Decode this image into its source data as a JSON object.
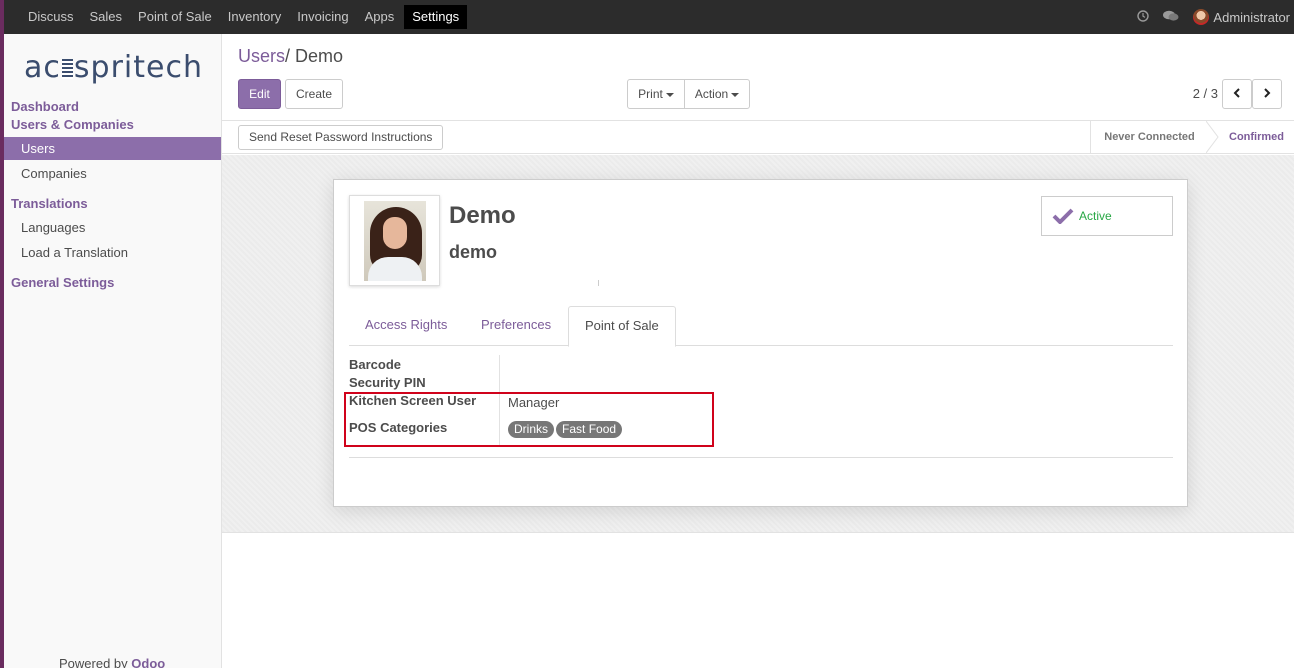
{
  "topnav": {
    "menus": [
      "Discuss",
      "Sales",
      "Point of Sale",
      "Inventory",
      "Invoicing",
      "Apps",
      "Settings"
    ],
    "active_menu": "Settings",
    "user": "Administrator",
    "icons": [
      "clock-icon",
      "chat-icon"
    ]
  },
  "sidebar": {
    "logo": "acspritech",
    "sections": [
      {
        "label": "Dashboard"
      },
      {
        "label": "Users & Companies"
      },
      {
        "label": "Translations"
      },
      {
        "label": "General Settings"
      }
    ],
    "items": [
      "Users",
      "Companies",
      "Languages",
      "Load a Translation"
    ],
    "active_item": "Users",
    "powered_prefix": "Powered by",
    "powered_brand": "Odoo"
  },
  "controlpanel": {
    "breadcrumb_parent": "Users",
    "breadcrumb_sep": "/",
    "breadcrumb_current": "Demo",
    "edit_label": "Edit",
    "create_label": "Create",
    "print_label": "Print",
    "action_label": "Action",
    "pager": "2 / 3"
  },
  "statusbar": {
    "reset_label": "Send Reset Password Instructions",
    "stages": [
      "Never Connected",
      "Confirmed"
    ],
    "current_stage": "Confirmed"
  },
  "form": {
    "name": "Demo",
    "login": "demo",
    "active_label": "Active",
    "tabs": [
      "Access Rights",
      "Preferences",
      "Point of Sale"
    ],
    "active_tab": "Point of Sale",
    "fields": {
      "barcode_label": "Barcode",
      "pin_label": "Security PIN",
      "kitchen_label": "Kitchen Screen User",
      "kitchen_value": "Manager",
      "pos_categories_label": "POS Categories",
      "pos_categories": [
        "Drinks",
        "Fast Food"
      ]
    }
  },
  "colors": {
    "brand": "#7c5c99",
    "brand_fill": "#8c6eaa",
    "topbar": "#2c2c2c",
    "highlight_box": "#d0021b",
    "active_green": "#28a745"
  }
}
